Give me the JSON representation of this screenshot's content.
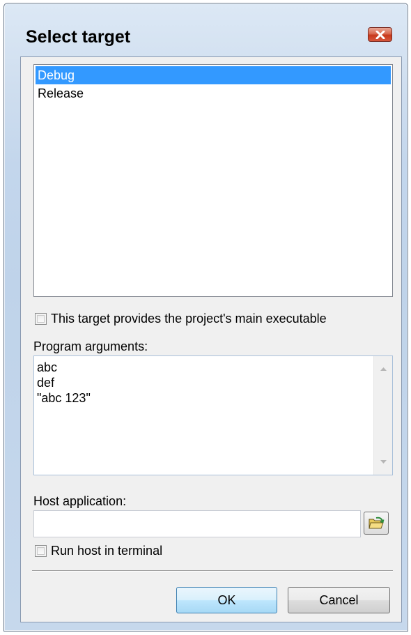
{
  "dialog": {
    "title": "Select target",
    "close_icon": "close-x-icon"
  },
  "targets": {
    "items": [
      "Debug",
      "Release"
    ],
    "selected": "Debug"
  },
  "main_executable_checkbox": {
    "label": "This target provides the project's main executable",
    "checked": false
  },
  "program_arguments": {
    "label": "Program arguments:",
    "lines": [
      "abc",
      "def",
      "\"abc 123\""
    ]
  },
  "host_application": {
    "label": "Host application:",
    "value": "",
    "browse_icon": "folder-open-icon"
  },
  "run_in_terminal_checkbox": {
    "label": "Run host in terminal",
    "checked": false
  },
  "buttons": {
    "ok": "OK",
    "cancel": "Cancel"
  },
  "colors": {
    "selection": "#3399ff",
    "close_button": "#c7391c"
  }
}
